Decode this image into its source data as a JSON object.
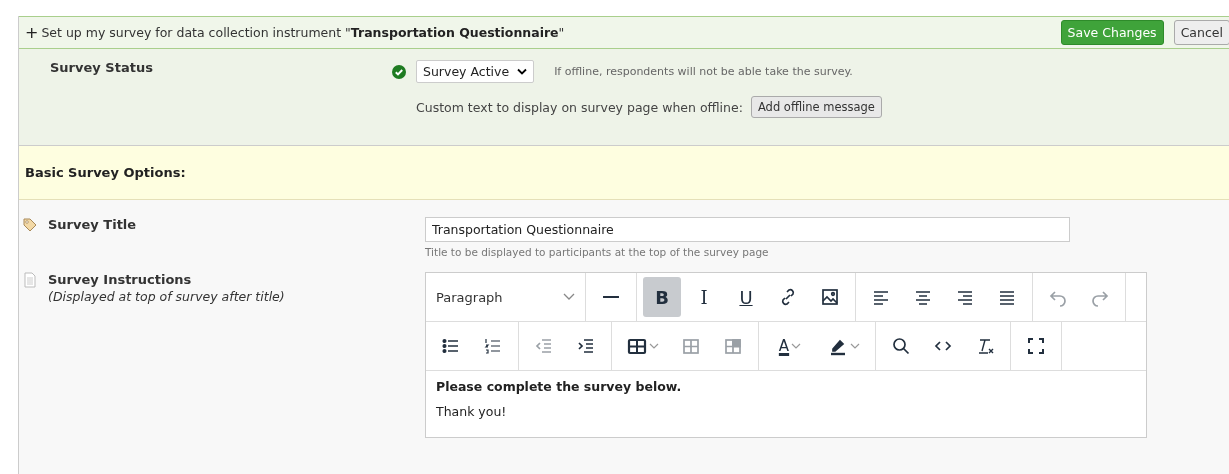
{
  "header": {
    "expand_glyph": "+",
    "text": "Set up my survey for data collection instrument \"**Transportation Questionnaire**\"",
    "save_button": "Save Changes",
    "cancel_button": "Cancel"
  },
  "status": {
    "label": "Survey Status",
    "active": true,
    "select_value": "Survey Active",
    "hint": "If offline, respondents will not be able take the survey.",
    "offline_label": "Custom text to display on survey page when offline:",
    "offline_button": "Add offline message"
  },
  "basic_options": {
    "heading": "Basic Survey Options:"
  },
  "title_field": {
    "label": "Survey Title",
    "value": "Transportation Questionnaire",
    "hint": "Title to be displayed to participants at the top of the survey page"
  },
  "instructions": {
    "label": "Survey Instructions",
    "sublabel": "(Displayed at top of survey after title)",
    "editor": {
      "block_format": "Paragraph",
      "toolbar_rows": [
        [
          [
            {
              "kind": "hr",
              "active": false,
              "disabled": false
            }
          ],
          [
            {
              "kind": "bold",
              "glyph": "B",
              "active": true,
              "disabled": false
            },
            {
              "kind": "italic",
              "glyph": "I",
              "active": false,
              "disabled": false
            },
            {
              "kind": "underline",
              "glyph": "U",
              "active": false,
              "disabled": false
            },
            {
              "kind": "link",
              "active": false,
              "disabled": false
            },
            {
              "kind": "image",
              "active": false,
              "disabled": false
            }
          ],
          [
            {
              "kind": "align-left",
              "active": false,
              "disabled": false
            },
            {
              "kind": "align-center",
              "active": false,
              "disabled": false
            },
            {
              "kind": "align-right",
              "active": false,
              "disabled": false
            },
            {
              "kind": "justify",
              "active": false,
              "disabled": false
            }
          ],
          [
            {
              "kind": "undo",
              "active": false,
              "disabled": true
            },
            {
              "kind": "redo",
              "active": false,
              "disabled": true
            }
          ]
        ],
        [
          [
            {
              "kind": "bullets",
              "active": false,
              "disabled": false
            },
            {
              "kind": "numbers",
              "active": false,
              "disabled": false
            }
          ],
          [
            {
              "kind": "outdent",
              "active": false,
              "disabled": true
            },
            {
              "kind": "indent",
              "active": false,
              "disabled": false
            }
          ],
          [
            {
              "kind": "table",
              "active": false,
              "disabled": false
            },
            {
              "kind": "table-cells",
              "active": false,
              "disabled": true
            },
            {
              "kind": "table-cell",
              "active": false,
              "disabled": true
            }
          ],
          [
            {
              "kind": "font-color",
              "glyph": "A",
              "active": false,
              "disabled": false
            },
            {
              "kind": "highlight",
              "active": false,
              "disabled": false
            }
          ],
          [
            {
              "kind": "search",
              "active": false,
              "disabled": false
            },
            {
              "kind": "code",
              "active": false,
              "disabled": false
            },
            {
              "kind": "clear",
              "active": false,
              "disabled": false
            }
          ],
          [
            {
              "kind": "fullscreen",
              "active": false,
              "disabled": false
            }
          ]
        ]
      ],
      "content": [
        {
          "text": "Please complete the survey below.",
          "bold": true
        },
        {
          "text": "Thank you!",
          "bold": false
        }
      ]
    }
  }
}
